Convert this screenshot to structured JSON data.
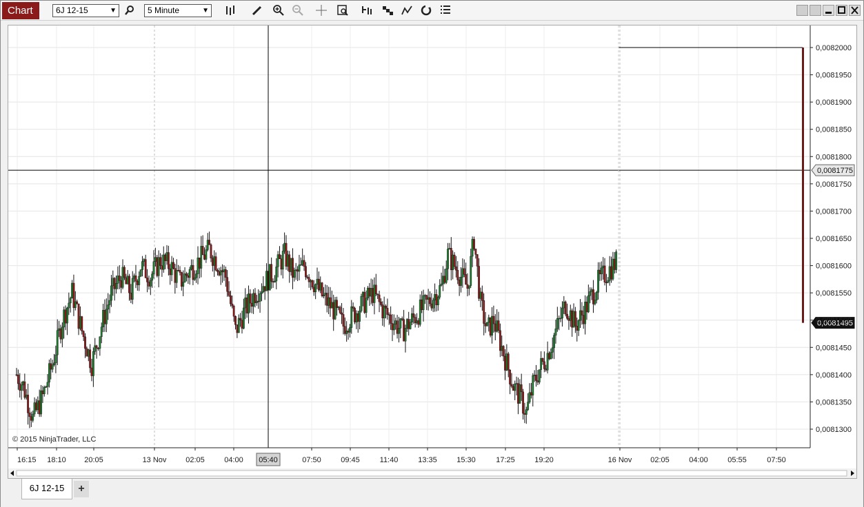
{
  "window": {
    "title": "Chart",
    "instrument": "6J 12-15",
    "interval": "5 Minute",
    "colors": {
      "title_bg": "#8b1a1a",
      "up_candle": "#1e7b2e",
      "down_candle": "#8b1a1a"
    }
  },
  "toolbar": {
    "icons": [
      "search-icon",
      "bar-type-icon",
      "pencil-icon",
      "zoom-in-icon",
      "zoom-out-icon",
      "crosshair-icon",
      "properties-icon",
      "indicators-icon",
      "strategies-icon",
      "drawing-tools-icon",
      "refresh-icon",
      "data-box-icon"
    ],
    "window_buttons": [
      "restore-icon",
      "restore-icon",
      "minimize-icon",
      "maximize-icon",
      "close-icon"
    ]
  },
  "chart": {
    "copyright": "© 2015 NinjaTrader, LLC",
    "price_labels": [
      "0,0082000",
      "0,0081950",
      "0,0081900",
      "0,0081850",
      "0,0081800",
      "0,0081750",
      "0,0081700",
      "0,0081650",
      "0,0081600",
      "0,0081550",
      "0,0081500",
      "0,0081450",
      "0,0081400",
      "0,0081350",
      "0,0081300"
    ],
    "crosshair_price": "0,0081775",
    "last_price": "0,0081495",
    "time_labels": [
      "16:15",
      "18:10",
      "20:05",
      "13 Nov",
      "02:05",
      "04:00",
      "05:40",
      "07:50",
      "09:45",
      "11:40",
      "13:35",
      "15:30",
      "17:25",
      "19:20",
      "16 Nov",
      "02:05",
      "04:00",
      "05:55",
      "07:50"
    ],
    "crosshair_time": "05:40"
  },
  "chart_data": {
    "type": "candlestick",
    "title": "",
    "ylim": [
      0.008127,
      0.008205
    ],
    "close_path": [
      [
        0,
        0.00814
      ],
      [
        4,
        0.008138
      ],
      [
        10,
        0.008132
      ],
      [
        16,
        0.008136
      ],
      [
        22,
        0.008142
      ],
      [
        28,
        0.00815
      ],
      [
        34,
        0.008155
      ],
      [
        40,
        0.008148
      ],
      [
        46,
        0.008142
      ],
      [
        52,
        0.008149
      ],
      [
        58,
        0.008155
      ],
      [
        64,
        0.008158
      ],
      [
        70,
        0.008155
      ],
      [
        76,
        0.00816
      ],
      [
        82,
        0.008158
      ],
      [
        88,
        0.008161
      ],
      [
        94,
        0.00816
      ],
      [
        100,
        0.008157
      ],
      [
        106,
        0.008159
      ],
      [
        112,
        0.008161
      ],
      [
        118,
        0.008163
      ],
      [
        124,
        0.00816
      ],
      [
        128,
        0.008158
      ],
      [
        134,
        0.008148
      ],
      [
        140,
        0.008152
      ],
      [
        146,
        0.008155
      ],
      [
        152,
        0.008157
      ],
      [
        158,
        0.008159
      ],
      [
        164,
        0.008162
      ],
      [
        170,
        0.008158
      ],
      [
        176,
        0.00816
      ],
      [
        182,
        0.008157
      ],
      [
        188,
        0.008154
      ],
      [
        194,
        0.008152
      ],
      [
        200,
        0.008149
      ],
      [
        206,
        0.008151
      ],
      [
        212,
        0.008153
      ],
      [
        218,
        0.008155
      ],
      [
        224,
        0.008152
      ],
      [
        230,
        0.00815
      ],
      [
        236,
        0.008148
      ],
      [
        242,
        0.00815
      ],
      [
        248,
        0.008152
      ],
      [
        254,
        0.008154
      ],
      [
        260,
        0.008156
      ],
      [
        264,
        0.008162
      ],
      [
        268,
        0.00816
      ],
      [
        272,
        0.008158
      ],
      [
        276,
        0.008156
      ],
      [
        280,
        0.008165
      ],
      [
        284,
        0.008153
      ],
      [
        288,
        0.008148
      ],
      [
        292,
        0.00815
      ],
      [
        296,
        0.008146
      ],
      [
        300,
        0.008142
      ],
      [
        304,
        0.008138
      ],
      [
        308,
        0.008136
      ],
      [
        312,
        0.008133
      ],
      [
        316,
        0.008138
      ],
      [
        320,
        0.008141
      ],
      [
        324,
        0.008143
      ],
      [
        330,
        0.008148
      ],
      [
        336,
        0.008153
      ],
      [
        342,
        0.008149
      ],
      [
        348,
        0.008152
      ],
      [
        356,
        0.008157
      ],
      [
        362,
        0.008159
      ],
      [
        368,
        0.008161
      ]
    ],
    "last_price": 0.0081495,
    "crosshair_price": 0.0081775
  }
}
